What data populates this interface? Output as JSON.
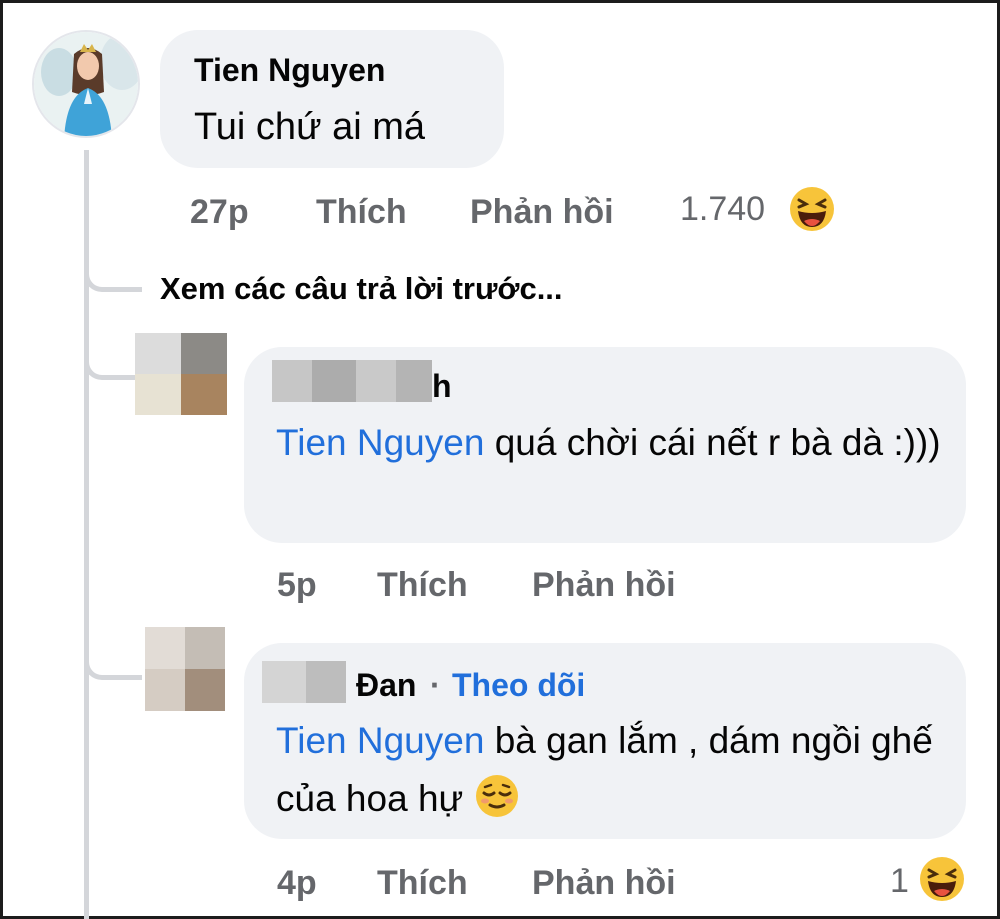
{
  "comment": {
    "author": "Tien Nguyen",
    "text": "Tui chứ ai má",
    "time": "27p",
    "like_label": "Thích",
    "reply_label": "Phản hồi",
    "reaction_count": "1.740",
    "reaction_icon": "laughing-emoji-icon"
  },
  "view_previous_replies": "Xem các câu trả lời trước...",
  "replies": [
    {
      "author_visible_suffix": "h",
      "mention": "Tien Nguyen",
      "text": " quá chời cái nết r bà dà :)))",
      "time": "5p",
      "like_label": "Thích",
      "reply_label": "Phản hồi"
    },
    {
      "author_visible_suffix": "Đan",
      "separator": "·",
      "follow_label": "Theo dõi",
      "mention": "Tien Nguyen",
      "text": " bà gan lắm , dám ngồi ghế của hoa hự ",
      "inline_emoji": "relieved-face-emoji-icon",
      "time": "4p",
      "like_label": "Thích",
      "reply_label": "Phản hồi",
      "reaction_count": "1",
      "reaction_icon": "laughing-emoji-icon"
    }
  ],
  "colors": {
    "mention": "#216fdb",
    "bubble": "#f0f2f5",
    "meta": "#65676b",
    "thread_line": "#d4d6da"
  }
}
